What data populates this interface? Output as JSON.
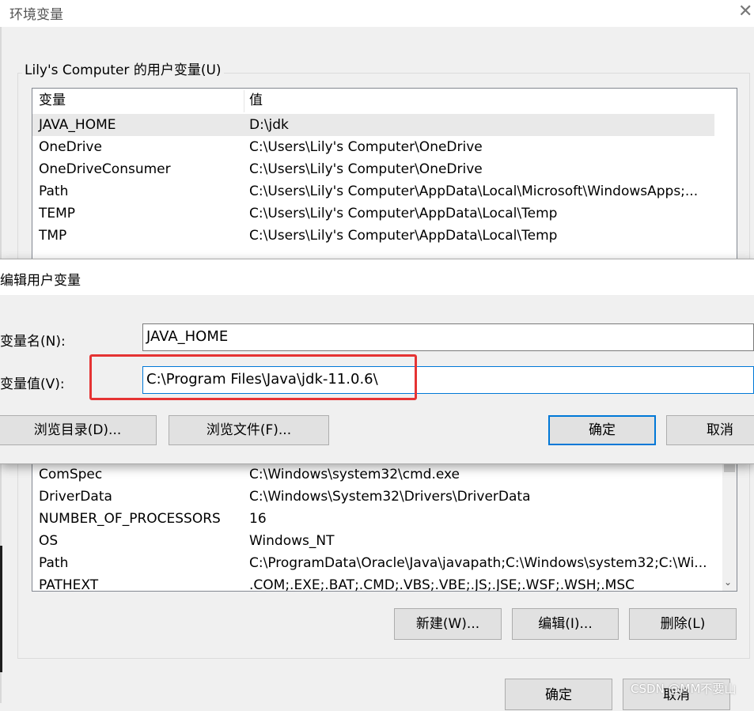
{
  "background_window": {
    "title": "环境变量",
    "close_glyph": "✕",
    "user_vars_title": "Lily's Computer 的用户变量(U)",
    "columns": [
      "变量",
      "值"
    ],
    "user_vars": [
      {
        "name": "JAVA_HOME",
        "value": "D:\\jdk"
      },
      {
        "name": "OneDrive",
        "value": "C:\\Users\\Lily's Computer\\OneDrive"
      },
      {
        "name": "OneDriveConsumer",
        "value": "C:\\Users\\Lily's Computer\\OneDrive"
      },
      {
        "name": "Path",
        "value": "C:\\Users\\Lily's Computer\\AppData\\Local\\Microsoft\\WindowsApps;..."
      },
      {
        "name": "TEMP",
        "value": "C:\\Users\\Lily's Computer\\AppData\\Local\\Temp"
      },
      {
        "name": "TMP",
        "value": "C:\\Users\\Lily's Computer\\AppData\\Local\\Temp"
      }
    ],
    "system_vars": [
      {
        "name": "ComSpec",
        "value": "C:\\Windows\\system32\\cmd.exe"
      },
      {
        "name": "DriverData",
        "value": "C:\\Windows\\System32\\Drivers\\DriverData"
      },
      {
        "name": "NUMBER_OF_PROCESSORS",
        "value": "16"
      },
      {
        "name": "OS",
        "value": "Windows_NT"
      },
      {
        "name": "Path",
        "value": "C:\\ProgramData\\Oracle\\Java\\javapath;C:\\Windows\\system32;C:\\Wi..."
      },
      {
        "name": "PATHEXT",
        "value": ".COM;.EXE;.BAT;.CMD;.VBS;.VBE;.JS;.JSE;.WSF;.WSH;.MSC"
      }
    ],
    "buttons": {
      "new": "新建(W)...",
      "edit": "编辑(I)...",
      "delete": "删除(L)",
      "ok": "确定",
      "cancel": "取消"
    }
  },
  "dialog": {
    "title": "编辑用户变量",
    "name_label": "变量名(N):",
    "value_label": "变量值(V):",
    "name_value": "JAVA_HOME",
    "value_value": "C:\\Program Files\\Java\\jdk-11.0.6\\",
    "buttons": {
      "browse_dir": "浏览目录(D)...",
      "browse_file": "浏览文件(F)...",
      "ok": "确定",
      "cancel": "取消"
    }
  },
  "watermark": "CSDN @MM不要山",
  "colors": {
    "highlight": "#e53333",
    "focus": "#0078d7"
  }
}
